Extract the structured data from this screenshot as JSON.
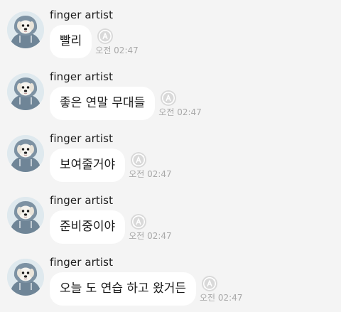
{
  "messages": [
    {
      "sender": "finger artist",
      "text": "빨리",
      "time": "오전 02:47"
    },
    {
      "sender": "finger artist",
      "text": "좋은 연말 무대들",
      "time": "오전 02:47"
    },
    {
      "sender": "finger artist",
      "text": "보여줄거야",
      "time": "오전 02:47"
    },
    {
      "sender": "finger artist",
      "text": "준비중이야",
      "time": "오전 02:47"
    },
    {
      "sender": "finger artist",
      "text": "오늘 도 연습 하고 왔거든",
      "time": "오전 02:47"
    }
  ],
  "icons": {
    "avatar": "dog-in-hoodie-avatar",
    "translate": "translate-icon"
  },
  "colors": {
    "background": "#f4f4f4",
    "bubble": "#ffffff",
    "sender_text": "#1e1e1e",
    "time_text": "#a9a9a9",
    "icon": "#c9c9c9"
  }
}
